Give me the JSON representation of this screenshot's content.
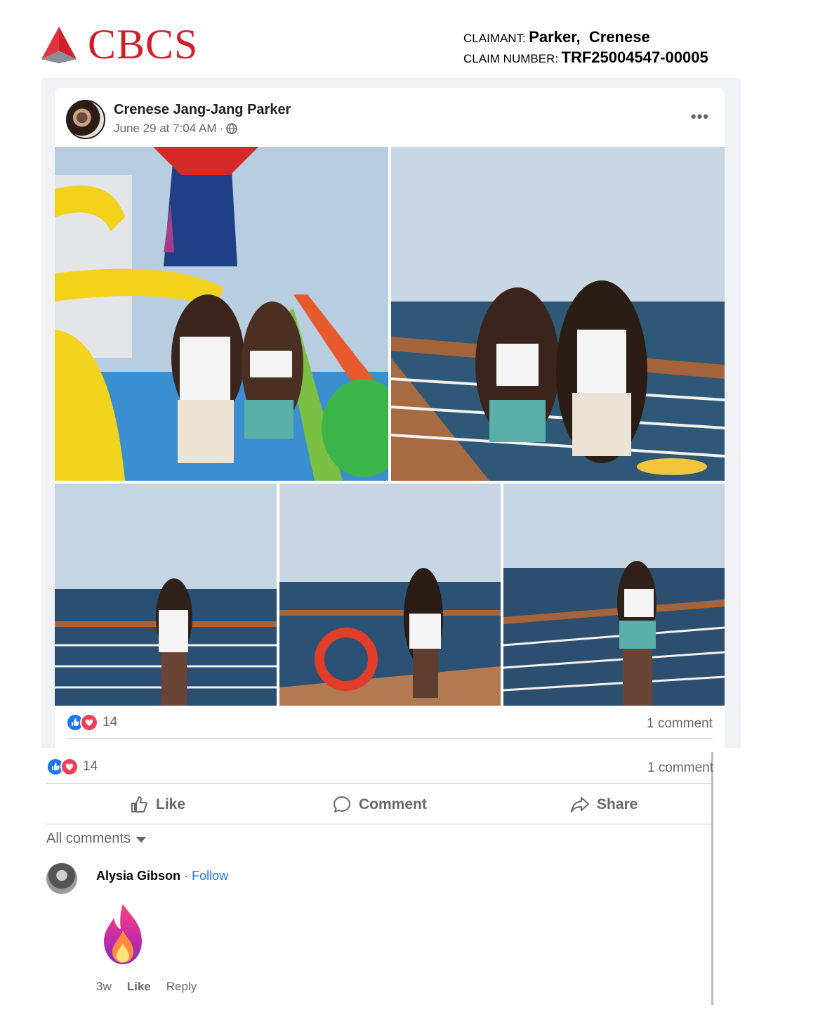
{
  "letterhead": {
    "logo_text": "CBCS",
    "claimant_label": "CLAIMANT:",
    "claimant_value": "Parker,  Crenese",
    "claim_number_label": "CLAIM NUMBER:",
    "claim_number_value": "TRF25004547-00005",
    "brand_color": "#d01f2b"
  },
  "post": {
    "author": "Crenese Jang-Jang Parker",
    "timestamp": "June 29 at 7:04 AM",
    "separator": "·",
    "privacy_icon": "globe-icon",
    "more_label": "•••",
    "reaction_count": "14",
    "comment_count": "1 comment"
  },
  "comments_panel": {
    "reaction_count": "14",
    "comment_count": "1 comment",
    "actions": {
      "like": "Like",
      "comment": "Comment",
      "share": "Share"
    },
    "filter_label": "All comments",
    "comment": {
      "author": "Alysia Gibson",
      "separator": "·",
      "follow": "Follow",
      "content_icon": "fire-emoji",
      "age": "3w",
      "like": "Like",
      "reply": "Reply"
    }
  },
  "colors": {
    "facebook_blue": "#1877f2",
    "love_red": "#f33e58",
    "secondary_text": "#65676b"
  }
}
